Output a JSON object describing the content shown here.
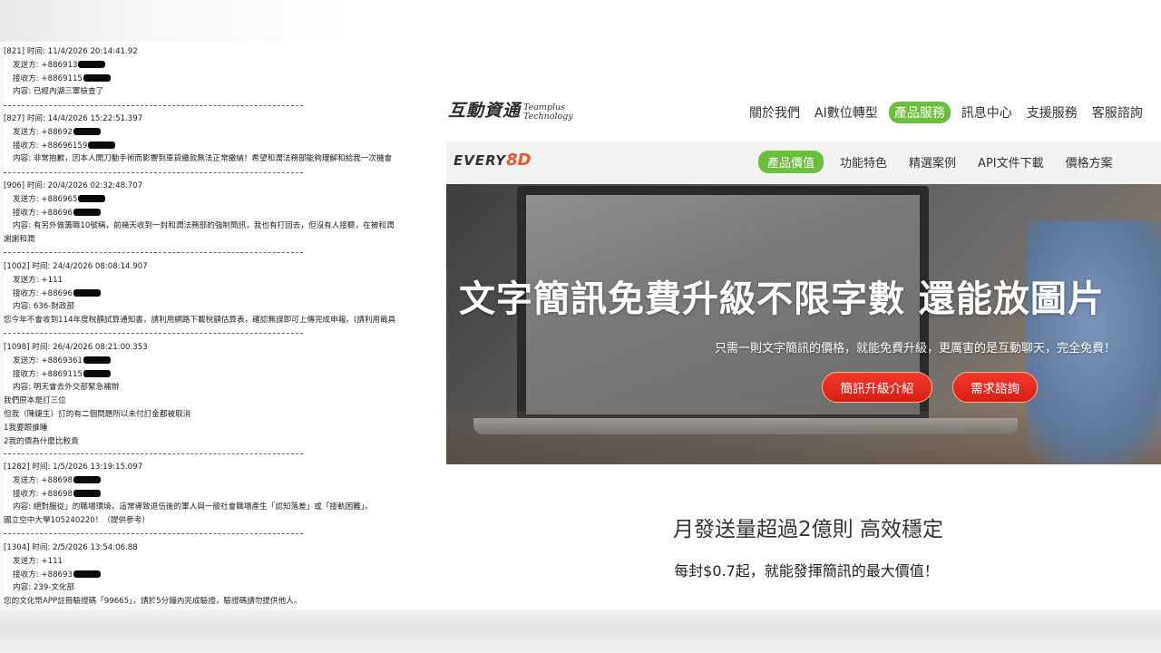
{
  "sms_log": {
    "divider": "------------------------------------------------------------------------------------------",
    "entries": [
      {
        "header": "[821] 时间: 11/4/2026 20:14:41.92",
        "sender": "发送方: +886913",
        "receiver": "接收方: +8869115",
        "content": "内容: 已經內湖三軍檢查了",
        "extra": []
      },
      {
        "header": "[827] 时间: 14/4/2026 15:22:51.397",
        "sender": "发送方: +88692",
        "receiver": "接收方: +88696159",
        "content": "内容: 非常抱歉，因本人開刀動手術而影響到車貸繳款無法正常繳納！希望和潤法務部能夠理解和給我一次機會",
        "extra": []
      },
      {
        "header": "[906] 时间: 20/4/2026 02:32:48.707",
        "sender": "发送方: +886965",
        "receiver": "接收方: +88696",
        "content": "内容: 有另外做籌職10號稱，前幾天收到一封和潤法務部的強制簡訊，我也有打回去，但沒有人接聽，在被和潤",
        "extra": [
          "謝謝和潤"
        ]
      },
      {
        "header": "[1002] 时间: 24/4/2026 08:08:14.907",
        "sender": "发送方: +111",
        "receiver": "接收方: +88696",
        "content": "内容: 636-財政部",
        "extra": [
          "您今年不會收到114年度稅額試算通知書，請利用網路下載稅額估算表，確認無誤即可上傳完成申報。(請利用截具"
        ]
      },
      {
        "header": "[1098] 时间: 26/4/2026 08:21:00.353",
        "sender": "发送方: +8869361",
        "receiver": "接收方: +8869115",
        "content": "内容: 明天會去外交部緊急補辦",
        "extra": [
          "我們原本是訂三位",
          "但我（陳婕生）訂的有二個問題所以未付訂金都被取消",
          "1我要跟誰睡",
          "2我的價為什麼比較貴"
        ]
      },
      {
        "header": "[1282] 时间: 1/5/2026 13:19:15.097",
        "sender": "发送方: +88698",
        "receiver": "接收方: +88698",
        "content": "内容: 絕對服從」的職場環境，這常導致退伍後的軍人與一般社會職場產生「認知落差」或「接軌困難」。",
        "extra": [
          "國立空中大學105240220！（提供參考）"
        ]
      },
      {
        "header": "[1304] 时间: 2/5/2026 13:54:06.88",
        "sender": "发送方: +111",
        "receiver": "接收方: +88693",
        "content": "内容: 239-文化部",
        "extra": [
          "您的文化幣APP註冊驗證碼「99665」，請於5分鐘內完成驗證，驗證碼請勿提供他人。"
        ]
      }
    ]
  },
  "website": {
    "brand": {
      "name_cn": "互動資通",
      "name_en_line1": "Teamplus",
      "name_en_line2": "Technology"
    },
    "main_menu": [
      {
        "label": "關於我們",
        "active": false
      },
      {
        "label": "AI數位轉型",
        "active": false
      },
      {
        "label": "產品服務",
        "active": true
      },
      {
        "label": "訊息中心",
        "active": false
      },
      {
        "label": "支援服務",
        "active": false
      },
      {
        "label": "客服諮詢",
        "active": false
      }
    ],
    "product_logo": {
      "text": "EVERY",
      "number": "8D"
    },
    "sub_menu": [
      {
        "label": "產品價值",
        "active": true
      },
      {
        "label": "功能特色",
        "active": false
      },
      {
        "label": "精選案例",
        "active": false
      },
      {
        "label": "API文件下載",
        "active": false
      },
      {
        "label": "價格方案",
        "active": false
      }
    ],
    "hero": {
      "title": "文字簡訊免費升級不限字數 還能放圖片",
      "subtitle": "只需一則文字簡訊的價格，就能免費升級，更厲害的是互動聊天，完全免費！",
      "button_primary": "簡訊升級介紹",
      "button_secondary": "需求諮詢"
    },
    "section": {
      "title": "月發送量超過2億則 高效穩定",
      "subtitle": "每封$0.7起，就能發揮簡訊的最大價值！"
    },
    "colors": {
      "accent_green": "#6cbf3c",
      "button_red": "#e02a1e",
      "logo_orange": "#e8582a"
    }
  }
}
